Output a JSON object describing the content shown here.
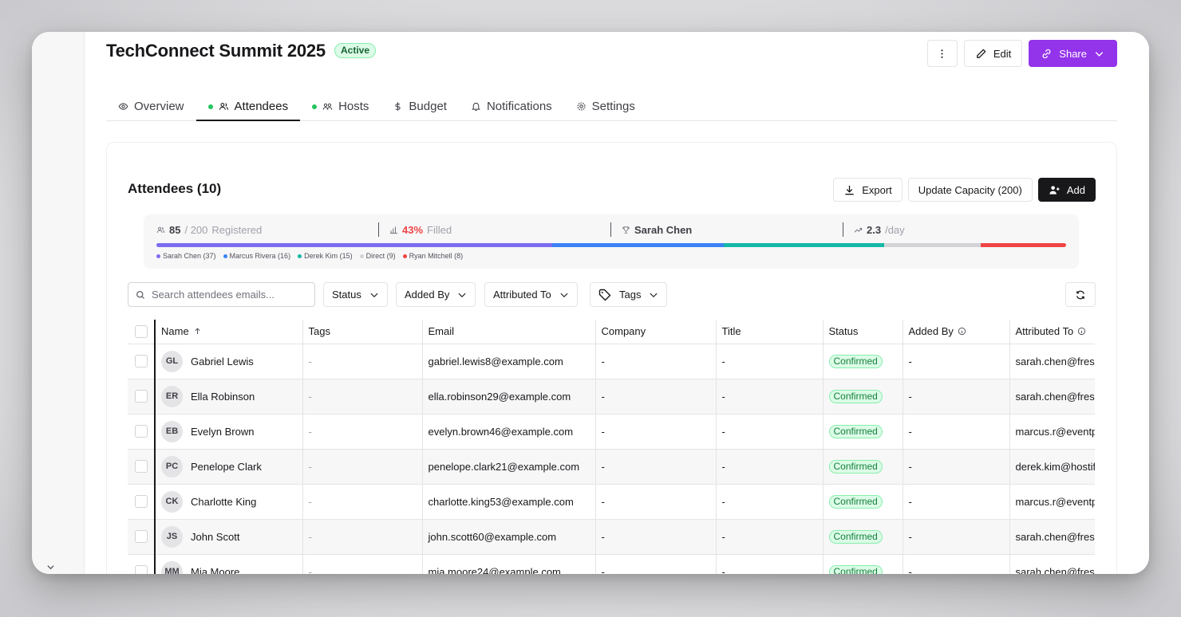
{
  "event": {
    "title": "TechConnect Summit 2025",
    "status": "Active"
  },
  "header_actions": {
    "edit_label": "Edit",
    "share_label": "Share"
  },
  "tabs": [
    {
      "label": "Overview",
      "icon": "eye-icon",
      "dot": false,
      "active": false
    },
    {
      "label": "Attendees",
      "icon": "users-icon",
      "dot": true,
      "active": true
    },
    {
      "label": "Hosts",
      "icon": "hosts-icon",
      "dot": true,
      "active": false
    },
    {
      "label": "Budget",
      "icon": "dollar-icon",
      "dot": false,
      "active": false
    },
    {
      "label": "Notifications",
      "icon": "bell-icon",
      "dot": false,
      "active": false
    },
    {
      "label": "Settings",
      "icon": "gear-icon",
      "dot": false,
      "active": false
    }
  ],
  "attendees": {
    "title": "Attendees (10)",
    "export_label": "Export",
    "capacity_label": "Update Capacity (200)",
    "add_label": "Add"
  },
  "stats": {
    "registered": "85",
    "capacity": "/ 200",
    "registered_label": "Registered",
    "filled_pct": "43%",
    "filled_label": "Filled",
    "top_host": "Sarah Chen",
    "rate": "2.3",
    "rate_unit": "/day",
    "segments": [
      {
        "name": "Sarah Chen",
        "count": 37,
        "color": "#7c6cf0"
      },
      {
        "name": "Marcus Rivera",
        "count": 16,
        "color": "#3b82f6"
      },
      {
        "name": "Derek Kim",
        "count": 15,
        "color": "#14b8a6"
      },
      {
        "name": "Direct",
        "count": 9,
        "color": "#d4d4d8"
      },
      {
        "name": "Ryan Mitchell",
        "count": 8,
        "color": "#ef4444"
      }
    ],
    "legend": [
      "Sarah Chen (37)",
      "Marcus Rivera (16)",
      "Derek Kim (15)",
      "Direct (9)",
      "Ryan Mitchell (8)"
    ]
  },
  "filters": {
    "search_placeholder": "Search attendees emails...",
    "status": "Status",
    "added_by": "Added By",
    "attributed_to": "Attributed To",
    "tags": "Tags"
  },
  "table": {
    "headers": [
      "Name",
      "Tags",
      "Email",
      "Company",
      "Title",
      "Status",
      "Added By",
      "Attributed To"
    ],
    "rows": [
      {
        "initials": "GL",
        "name": "Gabriel Lewis",
        "tags": "-",
        "email": "gabriel.lewis8@example.com",
        "company": "-",
        "title": "-",
        "status": "Confirmed",
        "added_by": "-",
        "attributed_to": "sarah.chen@fres"
      },
      {
        "initials": "ER",
        "name": "Ella Robinson",
        "tags": "-",
        "email": "ella.robinson29@example.com",
        "company": "-",
        "title": "-",
        "status": "Confirmed",
        "added_by": "-",
        "attributed_to": "sarah.chen@fres"
      },
      {
        "initials": "EB",
        "name": "Evelyn Brown",
        "tags": "-",
        "email": "evelyn.brown46@example.com",
        "company": "-",
        "title": "-",
        "status": "Confirmed",
        "added_by": "-",
        "attributed_to": "marcus.r@eventp"
      },
      {
        "initials": "PC",
        "name": "Penelope Clark",
        "tags": "-",
        "email": "penelope.clark21@example.com",
        "company": "-",
        "title": "-",
        "status": "Confirmed",
        "added_by": "-",
        "attributed_to": "derek.kim@hostif"
      },
      {
        "initials": "CK",
        "name": "Charlotte King",
        "tags": "-",
        "email": "charlotte.king53@example.com",
        "company": "-",
        "title": "-",
        "status": "Confirmed",
        "added_by": "-",
        "attributed_to": "marcus.r@eventp"
      },
      {
        "initials": "JS",
        "name": "John Scott",
        "tags": "-",
        "email": "john.scott60@example.com",
        "company": "-",
        "title": "-",
        "status": "Confirmed",
        "added_by": "-",
        "attributed_to": "sarah.chen@fres"
      },
      {
        "initials": "MM",
        "name": "Mia Moore",
        "tags": "-",
        "email": "mia.moore24@example.com",
        "company": "-",
        "title": "-",
        "status": "Confirmed",
        "added_by": "-",
        "attributed_to": "sarah.chen@fres"
      }
    ]
  }
}
